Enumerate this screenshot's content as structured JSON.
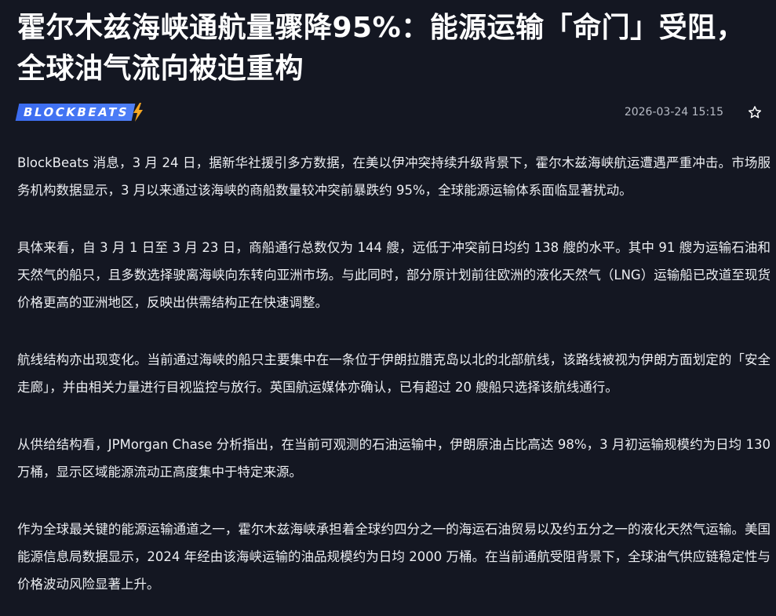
{
  "article": {
    "title": "霍尔木兹海峡通航量骤降95%：能源运输「命门」受阻，全球油气流向被迫重构",
    "source_logo": "BLOCKBEATS",
    "datetime": "2026-03-24 15:15",
    "paragraphs": [
      "BlockBeats 消息，3 月 24 日，据新华社援引多方数据，在美以伊冲突持续升级背景下，霍尔木兹海峡航运遭遇严重冲击。市场服务机构数据显示，3 月以来通过该海峡的商船数量较冲突前暴跌约 95%，全球能源运输体系面临显著扰动。",
      "具体来看，自 3 月 1 日至 3 月 23 日，商船通行总数仅为 144 艘，远低于冲突前日均约 138 艘的水平。其中 91 艘为运输石油和天然气的船只，且多数选择驶离海峡向东转向亚洲市场。与此同时，部分原计划前往欧洲的液化天然气（LNG）运输船已改道至现货价格更高的亚洲地区，反映出供需结构正在快速调整。",
      "航线结构亦出现变化。当前通过海峡的船只主要集中在一条位于伊朗拉腊克岛以北的北部航线，该路线被视为伊朗方面划定的「安全走廊」，并由相关力量进行目视监控与放行。英国航运媒体亦确认，已有超过 20 艘船只选择该航线通行。",
      "从供给结构看，JPMorgan Chase 分析指出，在当前可观测的石油运输中，伊朗原油占比高达 98%，3 月初运输规模约为日均 130 万桶，显示区域能源流动正高度集中于特定来源。",
      "作为全球最关键的能源运输通道之一，霍尔木兹海峡承担着全球约四分之一的海运石油贸易以及约五分之一的液化天然气运输。美国能源信息局数据显示，2024 年经由该海峡运输的油品规模约为日均 2000 万桶。在当前通航受阻背景下，全球油气供应链稳定性与价格波动风险显著上升。"
    ]
  },
  "icons": {
    "logo_bolt": "lightning-bolt-icon",
    "favorite": "star-outline-icon"
  },
  "colors": {
    "background": "#141722",
    "logo_blue": "#3b6cf0",
    "bolt_orange": "#f5a623",
    "text": "#eceef2",
    "meta_text": "#b8bcc6"
  }
}
